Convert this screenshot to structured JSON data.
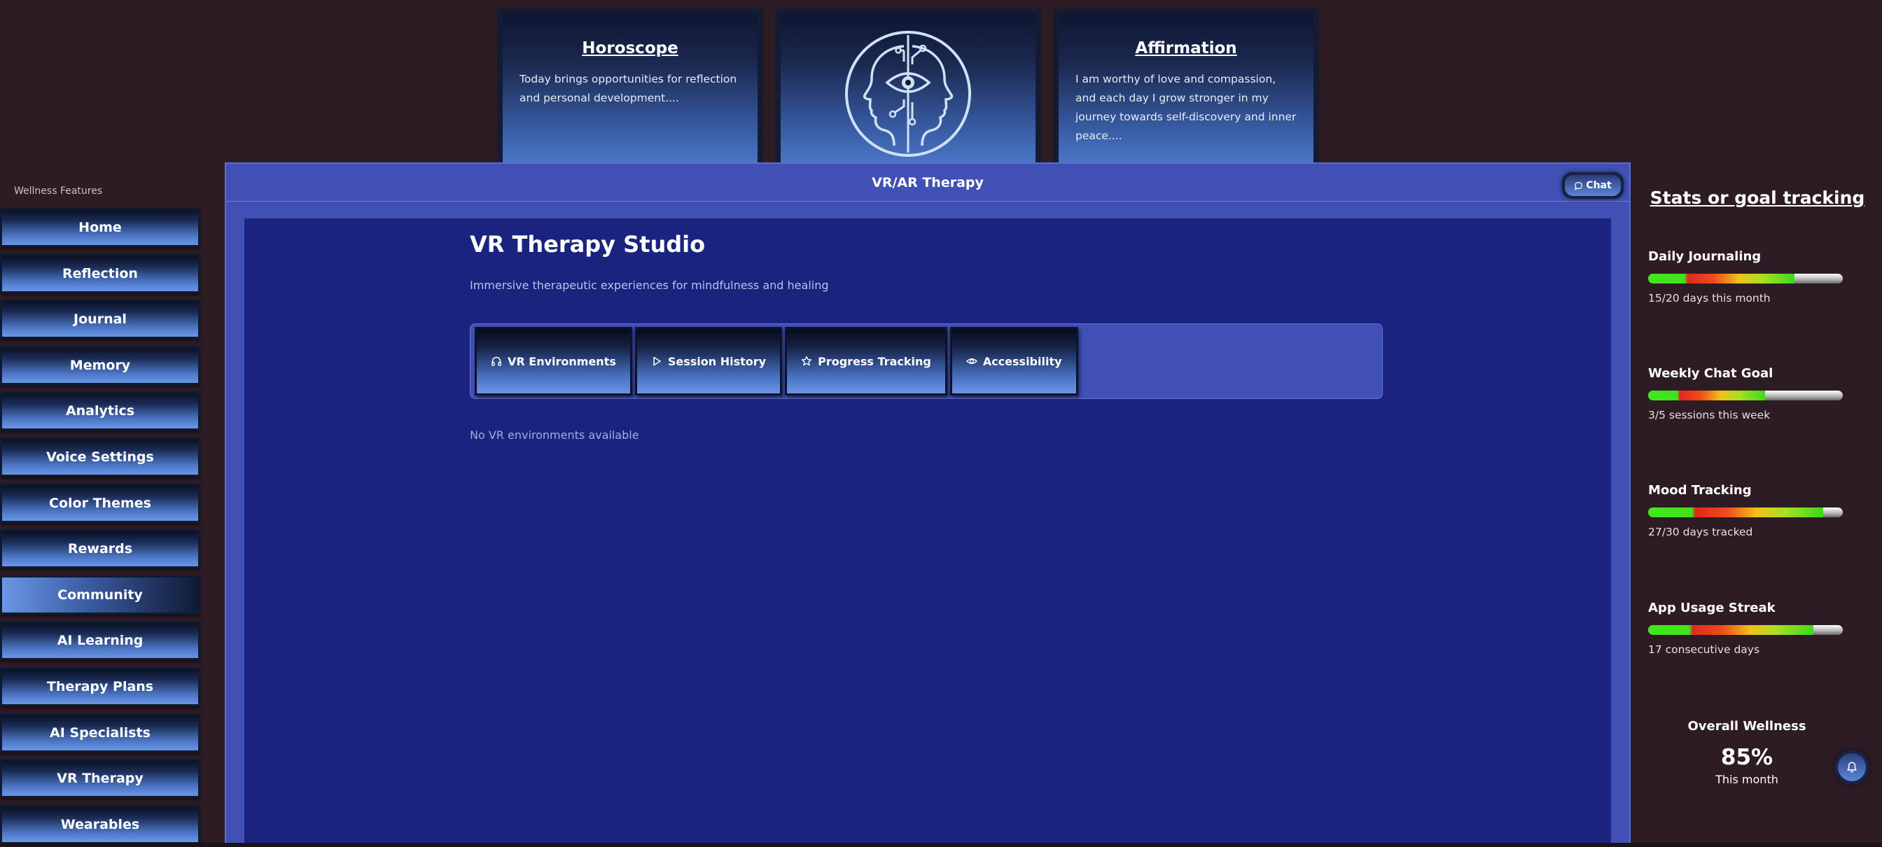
{
  "header_cards": {
    "horoscope": {
      "title": "Horoscope",
      "text": "Today brings opportunities for reflection and personal development...."
    },
    "logo": {
      "icon": "two-faces-third-eye-icon"
    },
    "affirmation": {
      "title": "Affirmation",
      "text": "I am worthy of love and compassion, and each day I grow stronger in my journey towards self-discovery and inner peace...."
    }
  },
  "sidebar": {
    "title": "Wellness Features",
    "active": "Community",
    "items": [
      {
        "label": "Home"
      },
      {
        "label": "Reflection"
      },
      {
        "label": "Journal"
      },
      {
        "label": "Memory"
      },
      {
        "label": "Analytics"
      },
      {
        "label": "Voice Settings"
      },
      {
        "label": "Color Themes"
      },
      {
        "label": "Rewards"
      },
      {
        "label": "Community"
      },
      {
        "label": "AI Learning"
      },
      {
        "label": "Therapy Plans"
      },
      {
        "label": "AI Specialists"
      },
      {
        "label": "VR Therapy"
      },
      {
        "label": "Wearables"
      }
    ]
  },
  "main": {
    "header_title": "VR/AR Therapy",
    "chat_label": "Chat",
    "studio_title": "VR Therapy Studio",
    "studio_subtitle": "Immersive therapeutic experiences for mindfulness and healing",
    "tabs": [
      {
        "label": "VR Environments",
        "icon": "headphones-icon"
      },
      {
        "label": "Session History",
        "icon": "play-icon"
      },
      {
        "label": "Progress Tracking",
        "icon": "star-icon"
      },
      {
        "label": "Accessibility",
        "icon": "eye-icon"
      }
    ],
    "empty_message": "No VR environments available"
  },
  "stats": {
    "title": "Stats or goal tracking",
    "goals": [
      {
        "name": "Daily Journaling",
        "detail": "15/20 days this month",
        "progress": 0.75
      },
      {
        "name": "Weekly Chat Goal",
        "detail": "3/5 sessions this week",
        "progress": 0.6
      },
      {
        "name": "Mood Tracking",
        "detail": "27/30 days tracked",
        "progress": 0.9
      },
      {
        "name": "App Usage Streak",
        "detail": "17 consecutive days",
        "progress": 0.85
      }
    ],
    "overall": {
      "label": "Overall Wellness",
      "value": "85%",
      "sub": "This month"
    }
  },
  "colors": {
    "page_bg": "#2e1c25",
    "panel": "#4150b5",
    "content": "#1a237e",
    "accent": "#5c87da"
  }
}
